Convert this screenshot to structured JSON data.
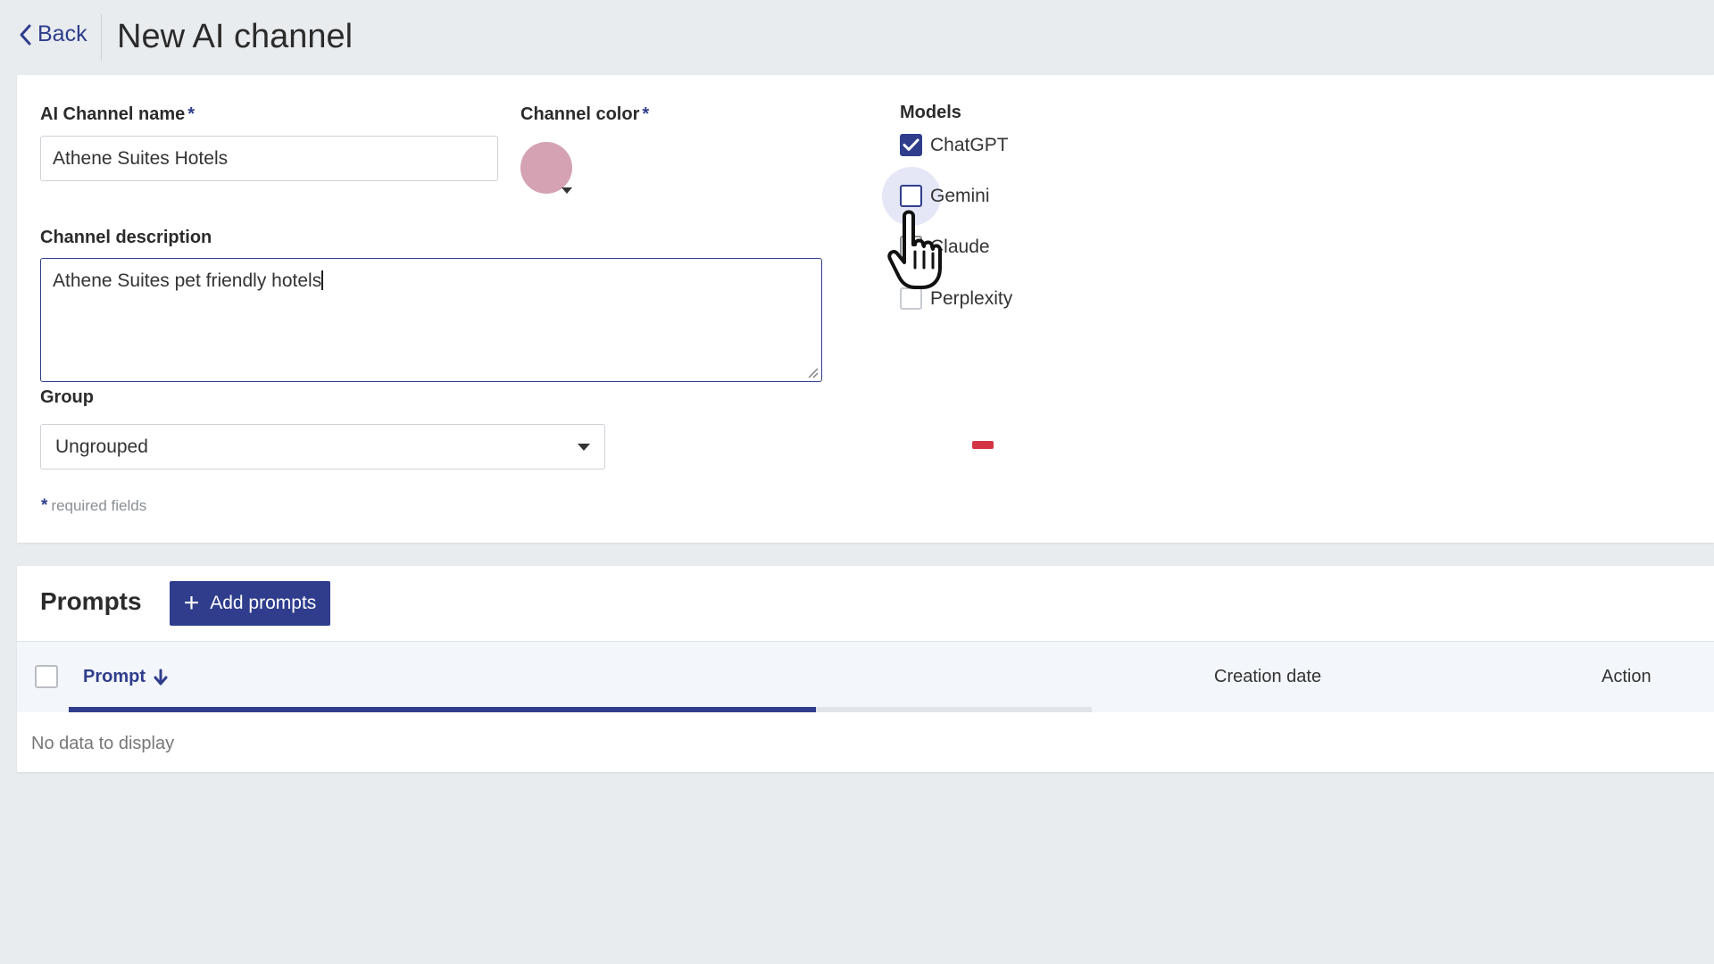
{
  "header": {
    "back_label": "Back",
    "title": "New AI channel"
  },
  "form": {
    "channel_name_label": "AI Channel name",
    "channel_name_value": "Athene Suites Hotels",
    "channel_color_label": "Channel color",
    "channel_color_value": "#d4a2b3",
    "description_label": "Channel description",
    "description_value": "Athene Suites pet friendly hotels",
    "group_label": "Group",
    "group_value": "Ungrouped",
    "required_star": "*",
    "required_note": "required fields"
  },
  "models": {
    "label": "Models",
    "items": [
      {
        "label": "ChatGPT",
        "checked": true
      },
      {
        "label": "Gemini",
        "checked": false
      },
      {
        "label": "Claude",
        "checked": false
      },
      {
        "label": "Perplexity",
        "checked": false
      }
    ]
  },
  "prompts": {
    "title": "Prompts",
    "add_button": "Add prompts",
    "columns": {
      "prompt": "Prompt",
      "creation_date": "Creation date",
      "action": "Action"
    },
    "loading_progress": 0.73,
    "empty_text": "No data to display"
  },
  "colors": {
    "accent": "#2f3d8c",
    "background": "#e9ecef",
    "swatch": "#d4a2b3"
  }
}
